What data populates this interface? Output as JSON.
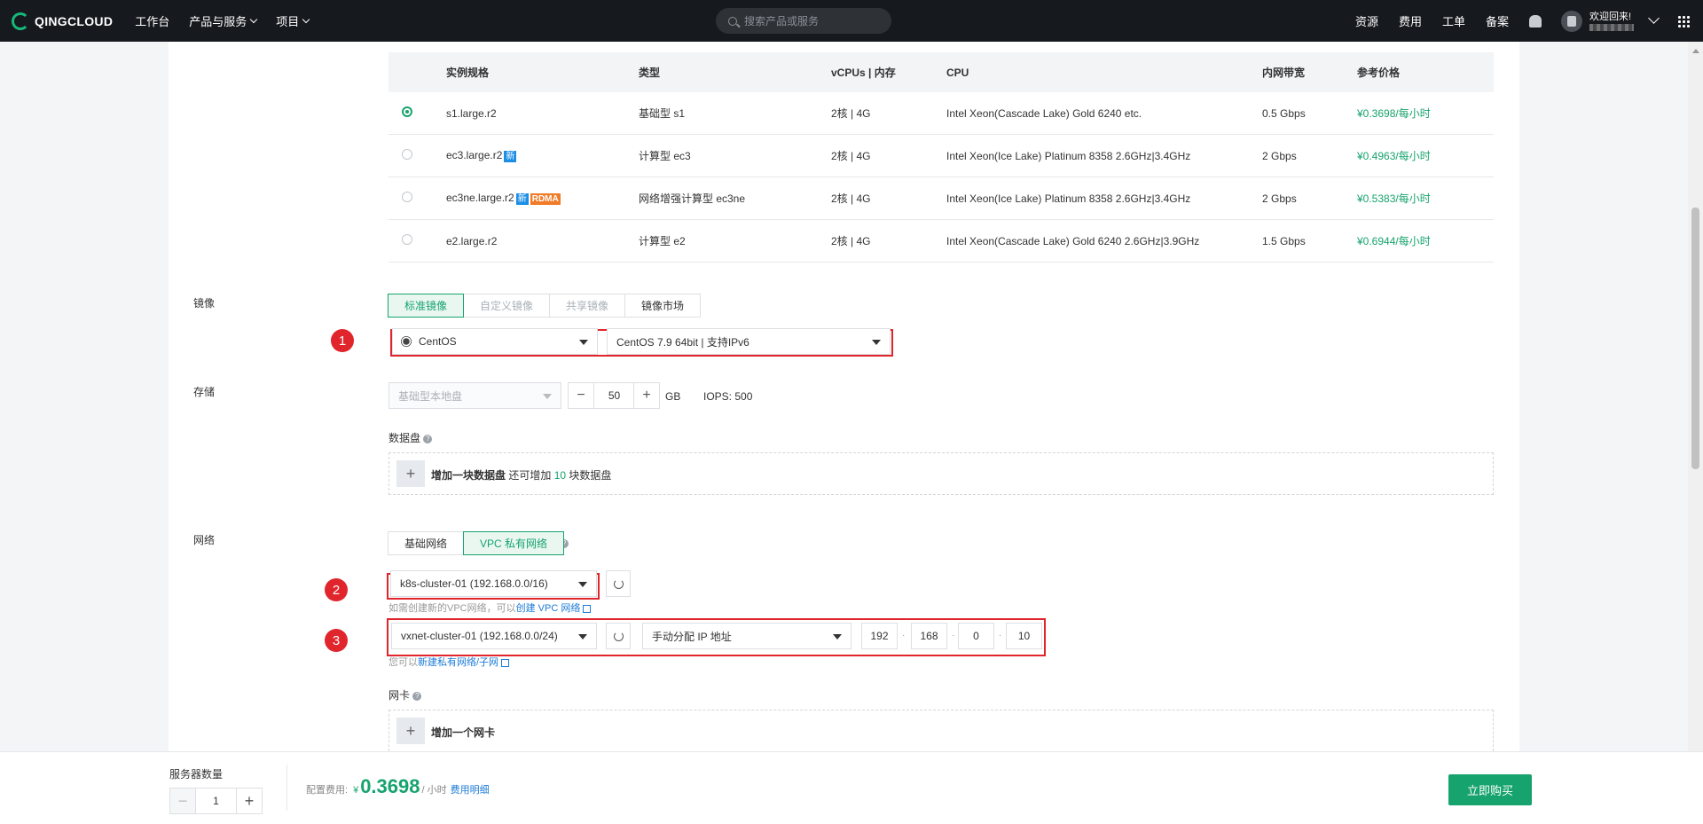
{
  "topbar": {
    "brand": "QINGCLOUD",
    "nav": [
      "工作台",
      "产品与服务",
      "项目"
    ],
    "search_placeholder": "搜索产品或服务",
    "links": [
      "资源",
      "费用",
      "工单",
      "备案"
    ],
    "welcome": "欢迎回来!"
  },
  "instance_table": {
    "headers": [
      "实例规格",
      "类型",
      "vCPUs | 内存",
      "CPU",
      "内网带宽",
      "参考价格"
    ],
    "rows": [
      {
        "selected": true,
        "spec": "s1.large.r2",
        "type": "基础型 s1",
        "cpus": "2核 | 4G",
        "cpu_name": "Intel Xeon(Cascade Lake) Gold 6240 etc.",
        "bandwidth": "0.5 Gbps",
        "price": "¥0.3698/每小时"
      },
      {
        "selected": false,
        "spec": "ec3.large.r2",
        "badge": "新",
        "type": "计算型 ec3",
        "cpus": "2核 | 4G",
        "cpu_name": "Intel Xeon(Ice Lake) Platinum 8358 2.6GHz|3.4GHz",
        "bandwidth": "2 Gbps",
        "price": "¥0.4963/每小时"
      },
      {
        "selected": false,
        "spec": "ec3ne.large.r2",
        "badge": "新",
        "badge2": "RDMA",
        "type": "网络增强计算型 ec3ne",
        "cpus": "2核 | 4G",
        "cpu_name": "Intel Xeon(Ice Lake) Platinum 8358 2.6GHz|3.4GHz",
        "bandwidth": "2 Gbps",
        "price": "¥0.5383/每小时"
      },
      {
        "selected": false,
        "spec": "e2.large.r2",
        "type": "计算型 e2",
        "cpus": "2核 | 4G",
        "cpu_name": "Intel Xeon(Cascade Lake) Gold 6240 2.6GHz|3.9GHz",
        "bandwidth": "1.5 Gbps",
        "price": "¥0.6944/每小时"
      }
    ]
  },
  "image": {
    "label": "镜像",
    "tabs": [
      "标准镜像",
      "自定义镜像",
      "共享镜像",
      "镜像市场"
    ],
    "os": "CentOS",
    "version": "CentOS 7.9 64bit | 支持IPv6",
    "badge": "1"
  },
  "storage": {
    "label": "存储",
    "disk_type": "基础型本地盘",
    "size": "50",
    "unit": "GB",
    "iops": "IOPS: 500",
    "data_disk_label": "数据盘",
    "add_disk": "增加一块数据盘",
    "add_disk_prefix": "还可增加",
    "add_disk_count": "10",
    "add_disk_suffix": "块数据盘"
  },
  "network": {
    "label": "网络",
    "tabs": [
      "基础网络",
      "VPC 私有网络"
    ],
    "vpc": "k8s-cluster-01 (192.168.0.0/16)",
    "vpc_hint": "如需创建新的VPC网络，可以",
    "vpc_hint_link": "创建 VPC 网络",
    "vxnet": "vxnet-cluster-01 (192.168.0.0/24)",
    "ip_mode": "手动分配 IP 地址",
    "ip": [
      "192",
      "168",
      "0",
      "10"
    ],
    "vxnet_hint": "您可以",
    "vxnet_hint_link": "新建私有网络/子网",
    "nic_label": "网卡",
    "add_nic": "增加一个网卡",
    "badge2": "2",
    "badge3": "3"
  },
  "bottom": {
    "qty_label": "服务器数量",
    "qty": "1",
    "fee_label": "配置费用:",
    "currency": "¥",
    "amount": "0.3698",
    "unit": "/ 小时",
    "detail_link": "费用明细",
    "buy": "立即购买"
  }
}
